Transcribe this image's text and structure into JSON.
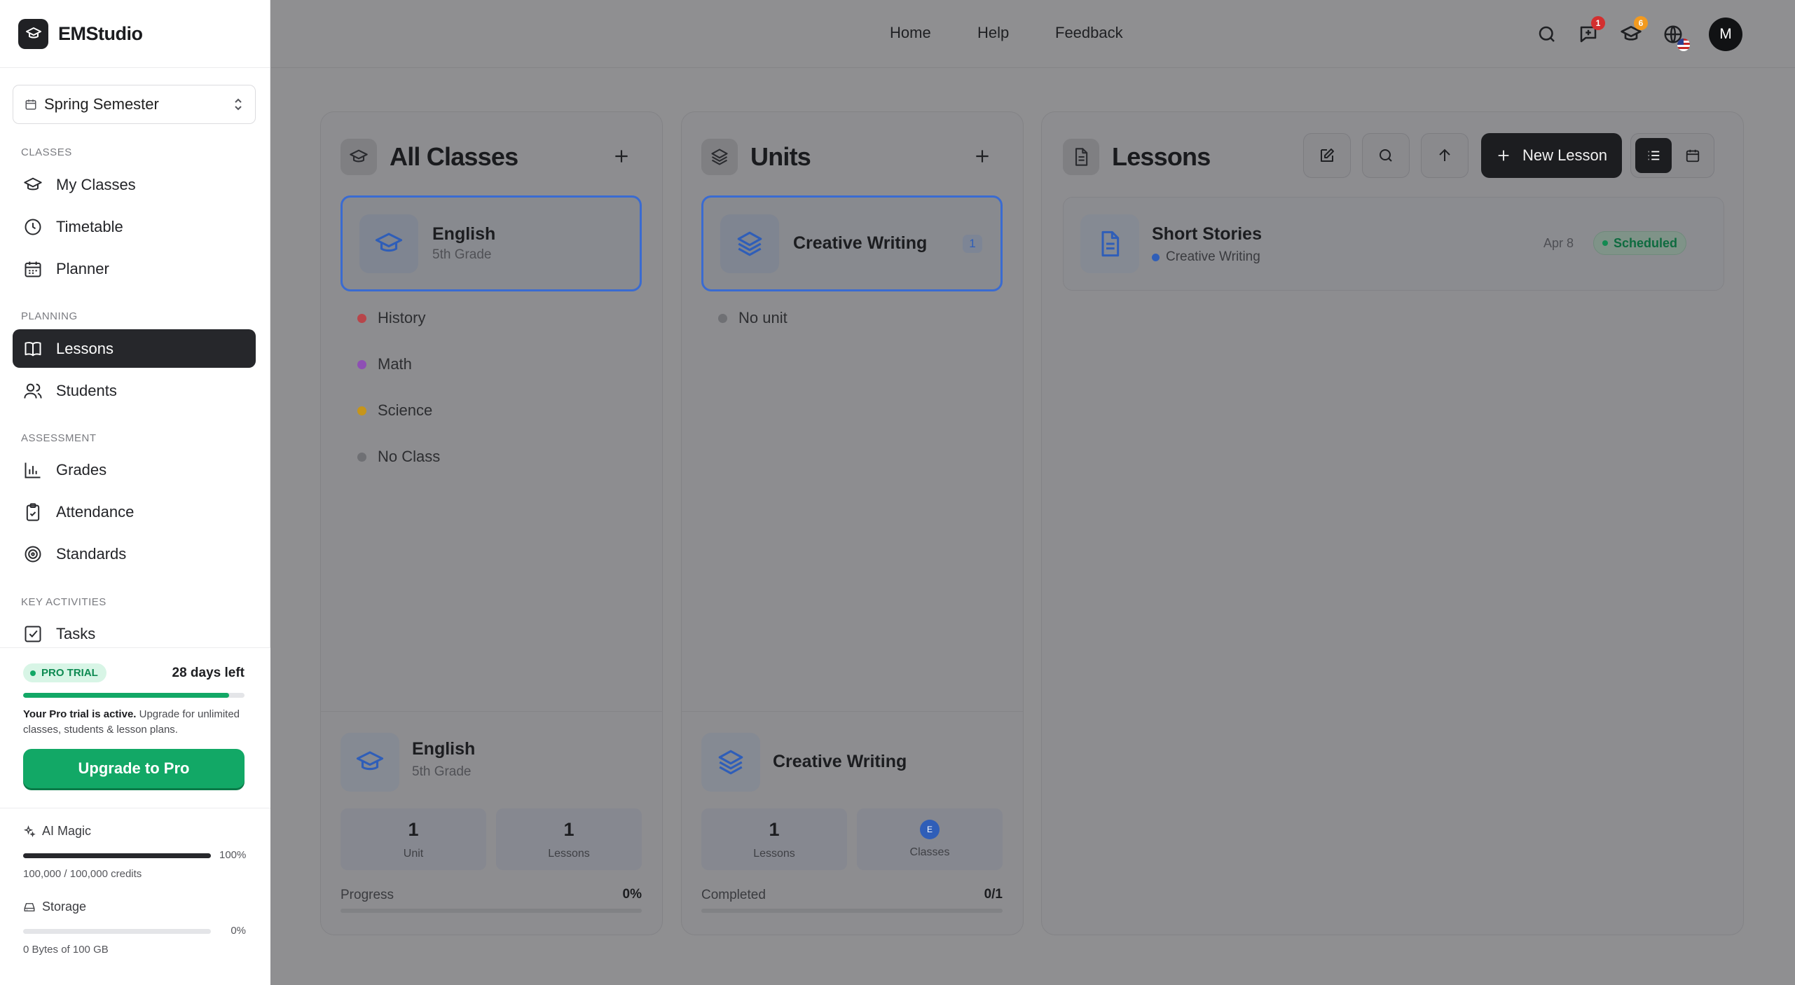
{
  "app": {
    "name": "EMStudio"
  },
  "semester": {
    "label": "Spring Semester"
  },
  "sidebar": {
    "sections": {
      "classes": "CLASSES",
      "planning": "PLANNING",
      "assessment": "ASSESSMENT",
      "key_activities": "KEY ACTIVITIES"
    },
    "items": {
      "my_classes": "My Classes",
      "timetable": "Timetable",
      "planner": "Planner",
      "lessons": "Lessons",
      "students": "Students",
      "grades": "Grades",
      "attendance": "Attendance",
      "standards": "Standards",
      "tasks": "Tasks"
    },
    "active": "lessons"
  },
  "trial": {
    "badge": "PRO TRIAL",
    "days_left": "28 days left",
    "progress": 0.93,
    "msg_bold": "Your Pro trial is active.",
    "msg": " Upgrade for unlimited classes, students & lesson plans.",
    "upgrade_label": "Upgrade to Pro"
  },
  "usage": {
    "ai": {
      "label": "AI Magic",
      "percent": "100%",
      "fraction": 1.0,
      "detail": "100,000 / 100,000 credits"
    },
    "storage": {
      "label": "Storage",
      "percent": "0%",
      "fraction": 0.0,
      "detail": "0 Bytes of 100 GB"
    }
  },
  "header": {
    "nav": {
      "home": "Home",
      "help": "Help",
      "feedback": "Feedback"
    },
    "badges": {
      "messages": "1",
      "classes": "6"
    },
    "avatar": "M",
    "colors": {
      "message_badge": "#d32f2f",
      "classes_badge": "#f29a1f"
    }
  },
  "classes_panel": {
    "title": "All Classes",
    "selected": {
      "title": "English",
      "sub": "5th Grade"
    },
    "items": [
      {
        "label": "History",
        "color": "#b8454a"
      },
      {
        "label": "Math",
        "color": "#8e4fb4"
      },
      {
        "label": "Science",
        "color": "#c6951a"
      },
      {
        "label": "No Class",
        "color": "#6f7074"
      }
    ],
    "footer": {
      "title": "English",
      "sub": "5th Grade",
      "stats": [
        {
          "num": "1",
          "cap": "Unit"
        },
        {
          "num": "1",
          "cap": "Lessons"
        }
      ],
      "progress_label": "Progress",
      "progress_value": "0%"
    }
  },
  "units_panel": {
    "title": "Units",
    "selected": {
      "title": "Creative Writing",
      "count": "1"
    },
    "items": [
      {
        "label": "No unit",
        "color": "#6f7074"
      }
    ],
    "footer": {
      "title": "Creative Writing",
      "stats": [
        {
          "num": "1",
          "cap": "Lessons"
        },
        {
          "badge": "E",
          "cap": "Classes"
        }
      ],
      "progress_label": "Completed",
      "progress_value": "0/1"
    }
  },
  "lessons_panel": {
    "title": "Lessons",
    "new_label": "New Lesson",
    "lessons": [
      {
        "title": "Short Stories",
        "unit": "Creative Writing",
        "date": "Apr 8",
        "status": "Scheduled"
      }
    ]
  }
}
